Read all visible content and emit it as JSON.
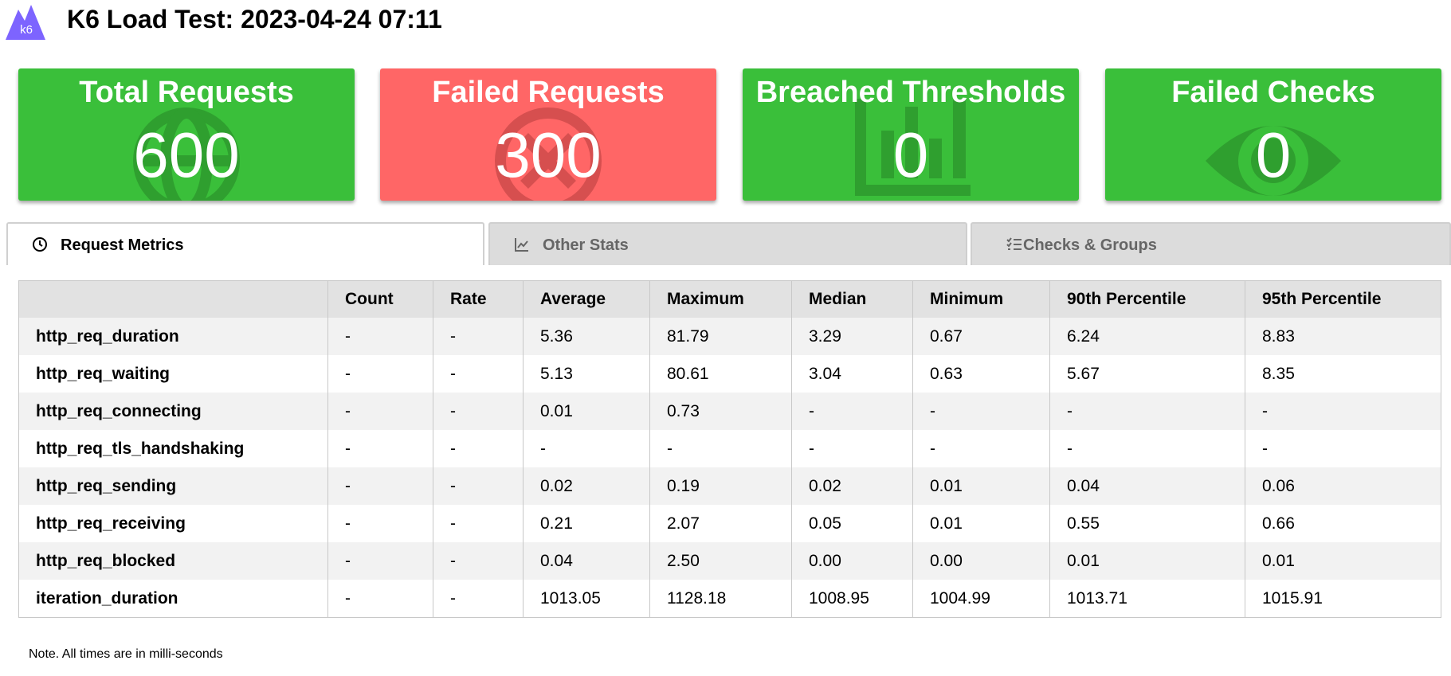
{
  "header": {
    "logo_text": "k6",
    "title": "K6 Load Test: 2023-04-24 07:11"
  },
  "cards": [
    {
      "title": "Total Requests",
      "value": "600",
      "status": "ok",
      "icon": "globe-icon"
    },
    {
      "title": "Failed Requests",
      "value": "300",
      "status": "failed",
      "icon": "x-circle-icon"
    },
    {
      "title": "Breached Thresholds",
      "value": "0",
      "status": "ok",
      "icon": "bar-chart-icon"
    },
    {
      "title": "Failed Checks",
      "value": "0",
      "status": "ok",
      "icon": "eye-icon"
    }
  ],
  "colors": {
    "ok": "#3abf3a",
    "failed": "#ff6666"
  },
  "tabs": [
    {
      "label": "Request Metrics",
      "icon": "clock-icon",
      "active": true
    },
    {
      "label": "Other Stats",
      "icon": "line-chart-icon",
      "active": false
    },
    {
      "label": "Checks & Groups",
      "icon": "checklist-icon",
      "active": false
    }
  ],
  "table": {
    "columns": [
      "",
      "Count",
      "Rate",
      "Average",
      "Maximum",
      "Median",
      "Minimum",
      "90th Percentile",
      "95th Percentile"
    ],
    "rows": [
      [
        "http_req_duration",
        "-",
        "-",
        "5.36",
        "81.79",
        "3.29",
        "0.67",
        "6.24",
        "8.83"
      ],
      [
        "http_req_waiting",
        "-",
        "-",
        "5.13",
        "80.61",
        "3.04",
        "0.63",
        "5.67",
        "8.35"
      ],
      [
        "http_req_connecting",
        "-",
        "-",
        "0.01",
        "0.73",
        "-",
        "-",
        "-",
        "-"
      ],
      [
        "http_req_tls_handshaking",
        "-",
        "-",
        "-",
        "-",
        "-",
        "-",
        "-",
        "-"
      ],
      [
        "http_req_sending",
        "-",
        "-",
        "0.02",
        "0.19",
        "0.02",
        "0.01",
        "0.04",
        "0.06"
      ],
      [
        "http_req_receiving",
        "-",
        "-",
        "0.21",
        "2.07",
        "0.05",
        "0.01",
        "0.55",
        "0.66"
      ],
      [
        "http_req_blocked",
        "-",
        "-",
        "0.04",
        "2.50",
        "0.00",
        "0.00",
        "0.01",
        "0.01"
      ],
      [
        "iteration_duration",
        "-",
        "-",
        "1013.05",
        "1128.18",
        "1008.95",
        "1004.99",
        "1013.71",
        "1015.91"
      ]
    ]
  },
  "note": "Note. All times are in milli-seconds"
}
